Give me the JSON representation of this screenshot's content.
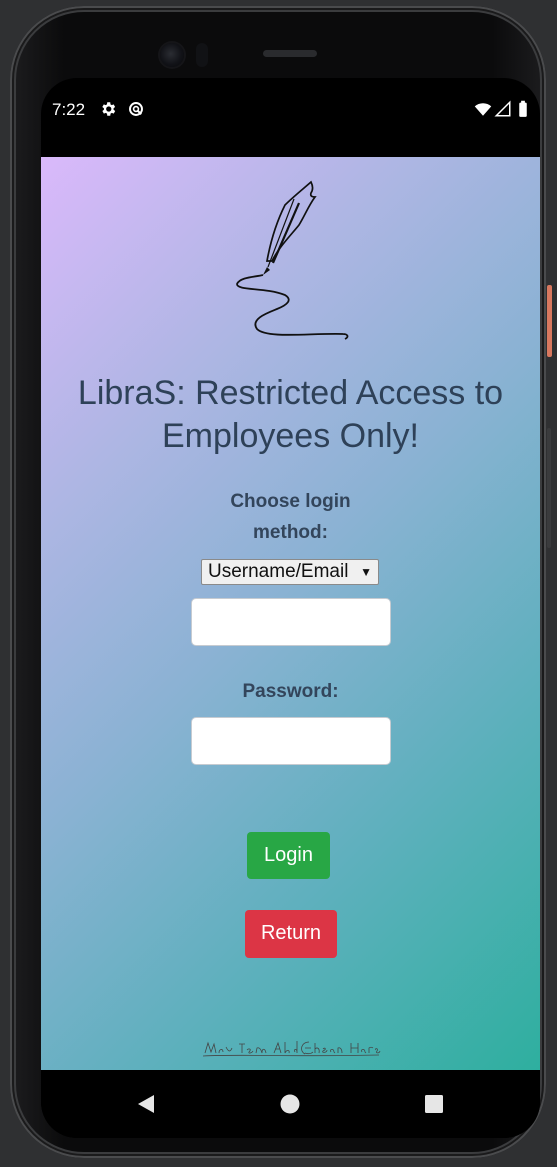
{
  "status_bar": {
    "time": "7:22",
    "icons": [
      "settings-gear-icon",
      "data-saver-icon",
      "wifi-icon",
      "cellular-signal-icon",
      "battery-icon"
    ]
  },
  "app": {
    "logo_icon": "quill-pen-signature-icon",
    "title_line1": "LibraS: Restricted Access to",
    "title_line2": "Employees Only!",
    "login_method_label_line1": "Choose login",
    "login_method_label_line2": "method:",
    "login_method_selected": "Username/Email",
    "username_value": "",
    "password_label": "Password:",
    "password_value": "",
    "login_button": "Login",
    "return_button": "Return",
    "signature_text": "Mia Tem Abd Ehsan Harsh"
  },
  "colors": {
    "gradient_start": "#dab9fb",
    "gradient_end": "#2eaf9f",
    "title_text": "#2e4158",
    "login_green": "#28a745",
    "return_red": "#dc3545"
  },
  "nav_bar": {
    "icons": [
      "back-triangle-icon",
      "home-circle-icon",
      "recents-square-icon"
    ]
  }
}
